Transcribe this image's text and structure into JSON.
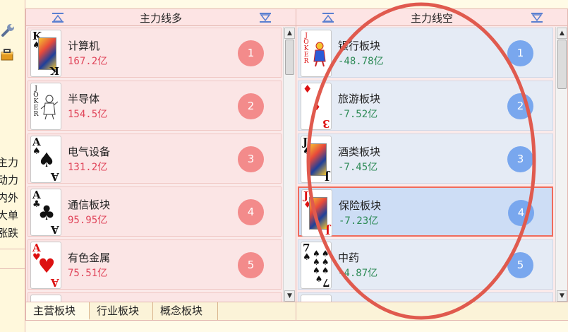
{
  "left_labels": [
    "主力",
    "动力",
    "内外",
    "大单",
    "涨跌"
  ],
  "left_panel": {
    "title": "主力线多",
    "rows": [
      {
        "name": "计算机",
        "value": "167.2亿",
        "rank": "1",
        "card": "K♠"
      },
      {
        "name": "半导体",
        "value": "154.5亿",
        "rank": "2",
        "card": "JOKER"
      },
      {
        "name": "电气设备",
        "value": "131.2亿",
        "rank": "3",
        "card": "A♠"
      },
      {
        "name": "通信板块",
        "value": "95.95亿",
        "rank": "4",
        "card": "A♣"
      },
      {
        "name": "有色金属",
        "value": "75.51亿",
        "rank": "5",
        "card": "A♥"
      }
    ]
  },
  "right_panel": {
    "title": "主力线空",
    "rows": [
      {
        "name": "银行板块",
        "value": "-48.78亿",
        "rank": "1",
        "card": "JOKER"
      },
      {
        "name": "旅游板块",
        "value": "-7.52亿",
        "rank": "2",
        "card": "3♦"
      },
      {
        "name": "酒类板块",
        "value": "-7.45亿",
        "rank": "3",
        "card": "J♠"
      },
      {
        "name": "保险板块",
        "value": "-7.23亿",
        "rank": "4",
        "card": "J♦"
      },
      {
        "name": "中药",
        "value": "-4.87亿",
        "rank": "5",
        "card": "7♠"
      }
    ]
  },
  "tabs": [
    "主营板块",
    "行业板块",
    "概念板块"
  ],
  "cards": {
    "k_spade": {
      "rank": "K",
      "suit": "♠"
    },
    "joker": {
      "letters": [
        "J",
        "O",
        "K",
        "E",
        "R"
      ]
    },
    "a_spade": {
      "rank": "A",
      "suit": "♠"
    },
    "a_club": {
      "rank": "A",
      "suit": "♣"
    },
    "a_heart": {
      "rank": "A",
      "suit": "♥"
    },
    "three_diamond": {
      "rank": "3",
      "suit": "♦"
    },
    "j_spade": {
      "rank": "J",
      "suit": "♠"
    },
    "j_diamond": {
      "rank": "J",
      "suit": "♦"
    },
    "seven_spade": {
      "rank": "7",
      "suit": "♠"
    }
  },
  "colors": {
    "long_value": "#e0455a",
    "short_value": "#2e8b57",
    "long_badge": "#f38b8b",
    "short_badge": "#79a7ee",
    "annotation": "#e05a4e"
  }
}
